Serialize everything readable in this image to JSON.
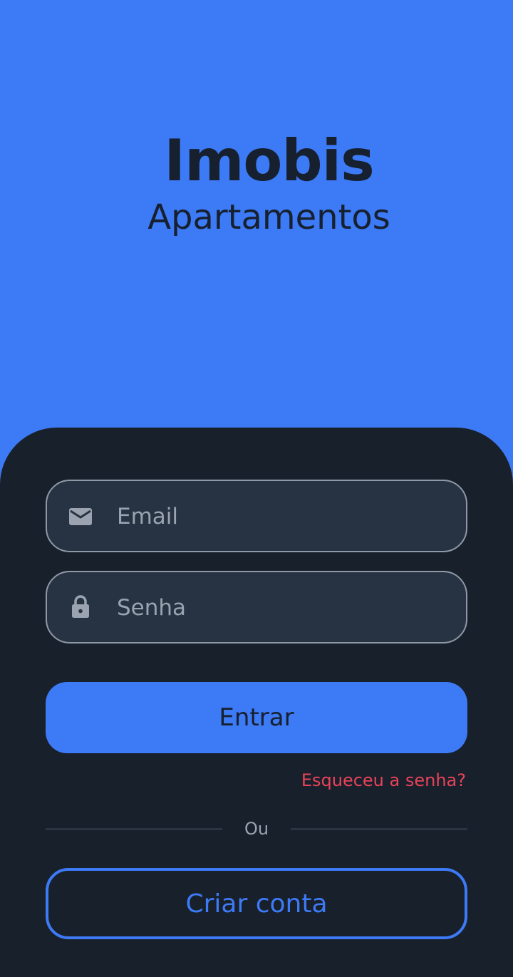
{
  "colors": {
    "accent": "#3d7af5",
    "panel": "#18202b",
    "field_bg": "#273343",
    "field_border": "#8f99a6",
    "text_dark": "#16202e",
    "danger": "#e8435a",
    "muted": "#9aa3af"
  },
  "hero": {
    "title": "Imobis",
    "subtitle": "Apartamentos"
  },
  "login": {
    "email": {
      "icon": "mail-icon",
      "placeholder": "Email",
      "value": ""
    },
    "password": {
      "icon": "lock-icon",
      "placeholder": "Senha",
      "value": ""
    },
    "submit_label": "Entrar",
    "forgot_label": "Esqueceu a senha?",
    "divider_label": "Ou",
    "create_account_label": "Criar conta"
  }
}
